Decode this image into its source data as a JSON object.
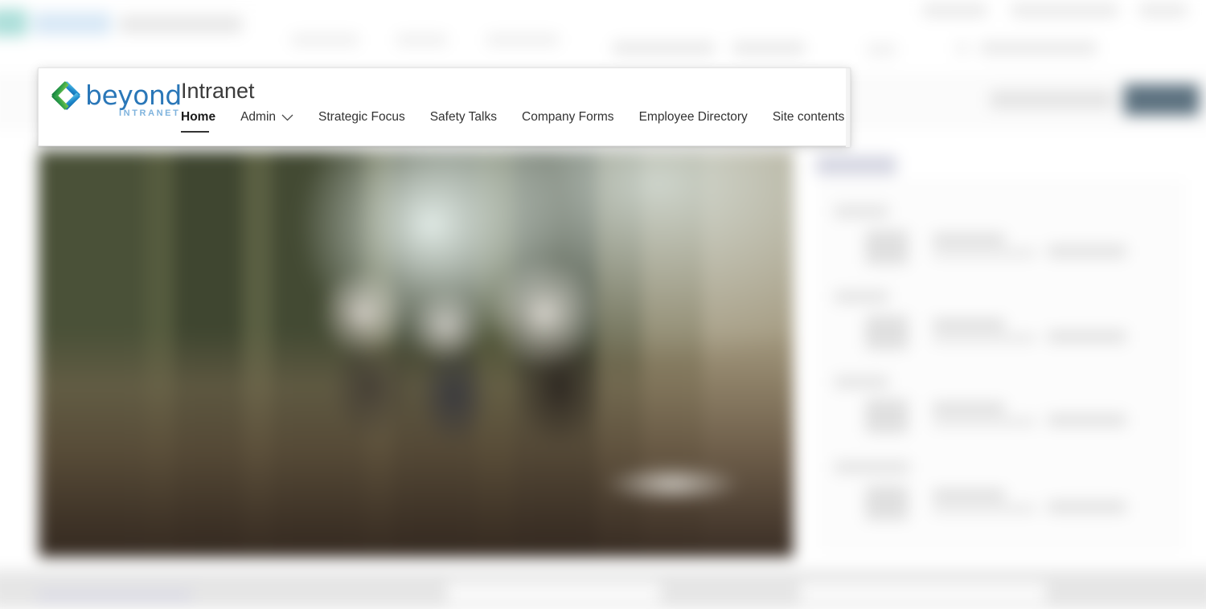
{
  "card": {
    "brand": {
      "logo_icon": "beyond-diamond-logo-icon",
      "wordmark": "beyond",
      "subtext": "INTRANET",
      "wordmark_color": "#2a77b8",
      "subtext_color": "#7fb3dd",
      "logo_blue": "#2f9ad6",
      "logo_green": "#3aa93f"
    },
    "site_title": "Intranet",
    "nav_items": [
      {
        "label": "Home",
        "active": true,
        "has_chevron": false
      },
      {
        "label": "Admin",
        "active": false,
        "has_chevron": true
      },
      {
        "label": "Strategic Focus",
        "active": false,
        "has_chevron": false
      },
      {
        "label": "Safety Talks",
        "active": false,
        "has_chevron": false
      },
      {
        "label": "Company Forms",
        "active": false,
        "has_chevron": false
      },
      {
        "label": "Employee Directory",
        "active": false,
        "has_chevron": false
      },
      {
        "label": "Site contents",
        "active": false,
        "has_chevron": false
      }
    ]
  },
  "background": {
    "description": "blurred SharePoint intranet home page behind the sharp navigation card",
    "hero_image_alt": "blurred outdoor forest photograph with three people",
    "panel_item_count": 4,
    "accent_button_color": "#5d7280",
    "panel_title_color": "#c9cada"
  }
}
